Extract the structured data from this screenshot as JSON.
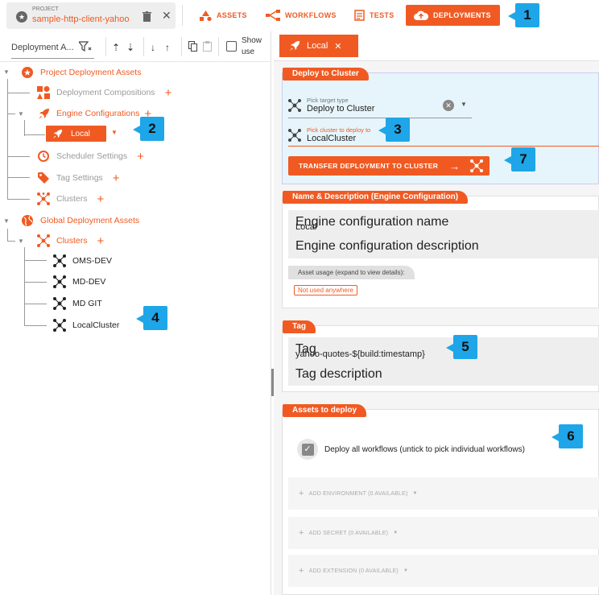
{
  "project": {
    "label": "PROJECT",
    "name": "sample-http-client-yahoo"
  },
  "nav": [
    {
      "label": "ASSETS",
      "icon": "shapes-icon"
    },
    {
      "label": "WORKFLOWS",
      "icon": "workflow-icon"
    },
    {
      "label": "TESTS",
      "icon": "tests-icon"
    },
    {
      "label": "DEPLOYMENTS",
      "icon": "cloud-upload-icon",
      "active": true
    }
  ],
  "left_toolbar": {
    "dropdown_value": "Deployment A...",
    "show_use_label": "Show use"
  },
  "tree": {
    "project_assets": "Project Deployment Assets",
    "deployment_compositions": "Deployment Compositions",
    "engine_configurations": "Engine Configurations",
    "local": "Local",
    "scheduler_settings": "Scheduler Settings",
    "tag_settings": "Tag Settings",
    "clusters": "Clusters",
    "global_assets": "Global Deployment Assets",
    "global_clusters": "Clusters",
    "cluster_items": [
      "OMS-DEV",
      "MD-DEV",
      "MD GIT",
      "LocalCluster"
    ]
  },
  "right": {
    "tab_label": "Local",
    "deploy_card": {
      "title": "Deploy to Cluster",
      "target_type_label": "Pick target type",
      "target_type_value": "Deploy to Cluster",
      "cluster_label": "Pick cluster to deploy to",
      "cluster_value": "LocalCluster",
      "transfer_button": "TRANSFER DEPLOYMENT TO CLUSTER"
    },
    "name_card": {
      "title": "Name & Description (Engine Configuration)",
      "name_label": "Engine configuration name",
      "name_value": "Local",
      "desc_label": "Engine configuration description",
      "usage_label": "Asset usage (expand to view details):",
      "usage_badge": "Not used anywhere"
    },
    "tag_card": {
      "title": "Tag",
      "tag_label": "Tag",
      "tag_value": "yahoo-quotes-${build:timestamp}",
      "desc_label": "Tag description"
    },
    "assets_card": {
      "title": "Assets to deploy",
      "deploy_all_label": "Deploy all workflows (untick to pick individual workflows)",
      "add_environment": "ADD ENVIRONMENT (0 AVAILABLE)",
      "add_secret": "ADD SECRET (0 AVAILABLE)",
      "add_extension": "ADD EXTENSION (0 AVAILABLE)"
    }
  },
  "callouts": [
    "1",
    "2",
    "3",
    "4",
    "5",
    "6",
    "7"
  ],
  "colors": {
    "accent": "#f05a22",
    "callout": "#1ea6e8",
    "deploy_bg": "#e6f5fb"
  }
}
